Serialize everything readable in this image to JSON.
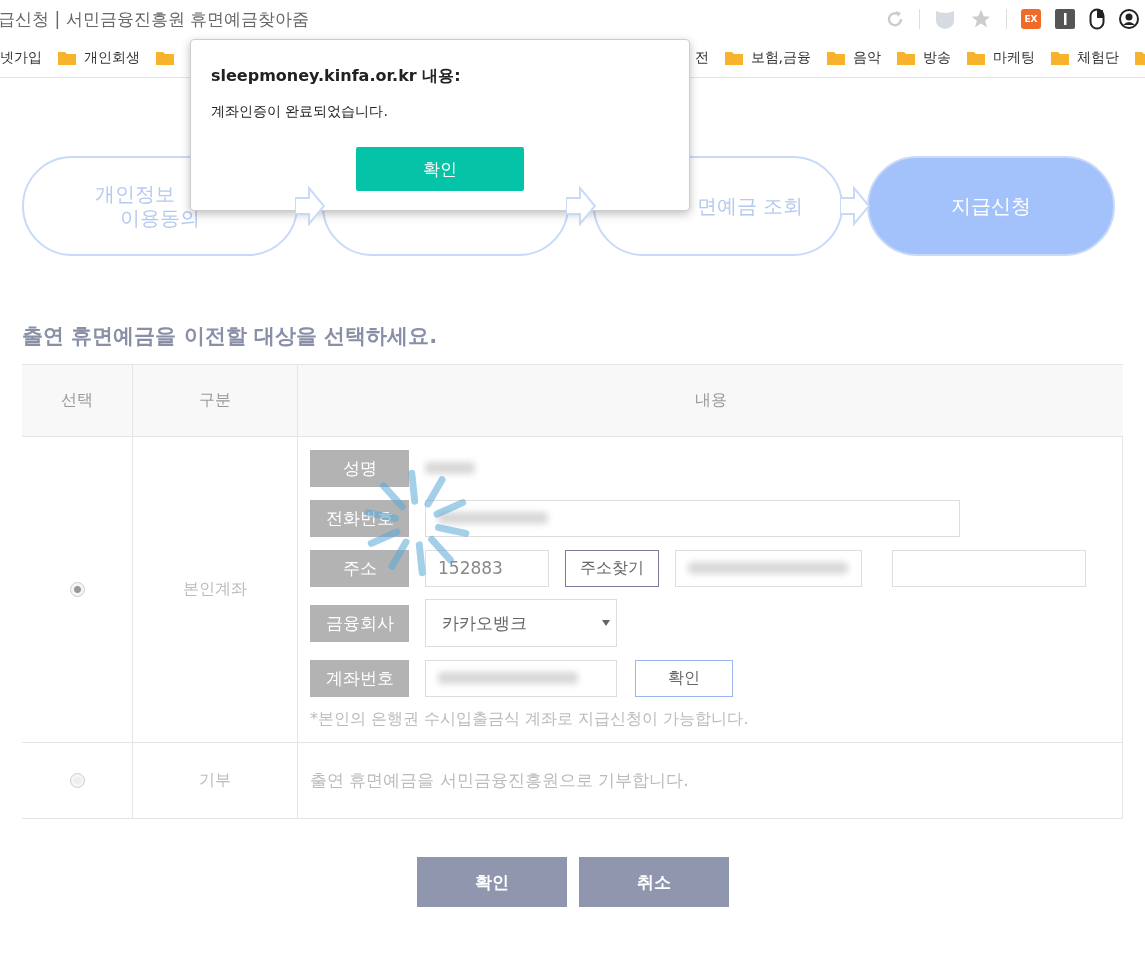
{
  "browser": {
    "tab_title": "급신청 | 서민금융진흥원 휴면예금찾아줌",
    "bookmarks": [
      {
        "label": "넷가입",
        "folder": false
      },
      {
        "label": "개인회생",
        "folder": true
      },
      {
        "folder": true
      },
      {
        "label": "전",
        "folder": false
      },
      {
        "label": "보험,금융",
        "folder": true
      },
      {
        "label": "음악",
        "folder": true
      },
      {
        "label": "방송",
        "folder": true
      },
      {
        "label": "마케팅",
        "folder": true
      },
      {
        "label": "체험단",
        "folder": true
      }
    ],
    "extension_badge": "EX"
  },
  "dialog": {
    "origin": "sleepmoney.kinfa.or.kr 내용:",
    "message": "계좌인증이 완료되었습니다.",
    "button": "확인"
  },
  "steps": [
    {
      "lines": [
        "개인정보",
        "이용동의"
      ],
      "selected": false
    },
    {
      "selected": false
    },
    {
      "lines": [
        "면예금 조회"
      ],
      "selected": false
    },
    {
      "lines": [
        "지급신청"
      ],
      "selected": true
    }
  ],
  "heading": "출연 휴면예금을 이전할 대상을 선택하세요.",
  "table": {
    "columns": [
      "선택",
      "구분",
      "내용"
    ],
    "rows": [
      {
        "kind": "account",
        "selected": true,
        "category": "본인계좌",
        "fields": [
          {
            "kind": "plain",
            "label": "성명"
          },
          {
            "kind": "phone",
            "label": "전화번호"
          },
          {
            "kind": "address",
            "label": "주소",
            "zip": "152883",
            "button": "주소찾기"
          },
          {
            "kind": "select",
            "label": "금융회사",
            "value": "카카오뱅크"
          },
          {
            "kind": "account",
            "label": "계좌번호",
            "button": "확인"
          }
        ],
        "note": "*본인의 은행권 수시입출금식 계좌로 지급신청이 가능합니다."
      },
      {
        "kind": "donation",
        "selected": false,
        "category": "기부",
        "text": "출연 휴면예금을 서민금융진흥원으로 기부합니다."
      }
    ]
  },
  "buttons": [
    "확인",
    "취소"
  ]
}
